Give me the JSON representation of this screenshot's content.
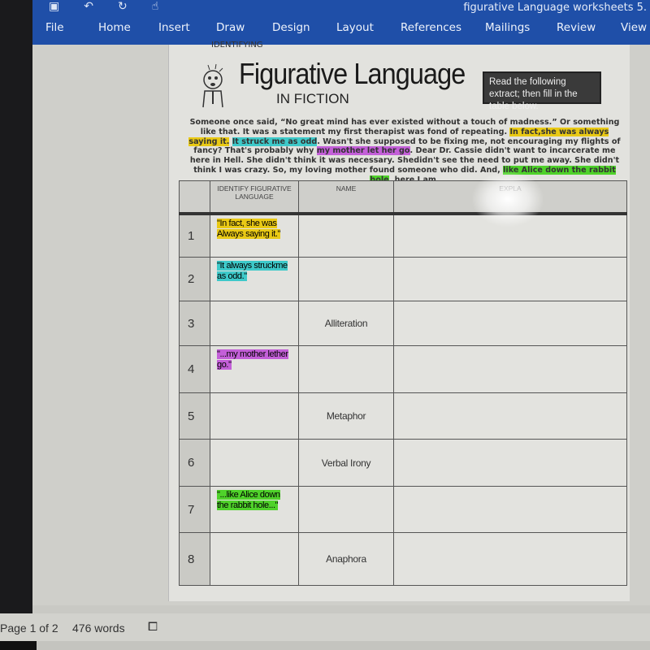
{
  "window": {
    "doc_title": "figurative Language worksheets 5."
  },
  "ribbon": {
    "tabs": [
      "File",
      "Home",
      "Insert",
      "Draw",
      "Design",
      "Layout",
      "References",
      "Mailings",
      "Review",
      "View"
    ]
  },
  "document": {
    "kicker": "IDENTIFYING",
    "title": "Figurative Language",
    "subtitle": "IN FICTION",
    "instructions": "Read the following extract; then fill in the table below.",
    "paragraph": [
      {
        "text": "Someone once said, “No great mind has ever existed without a touch of madness.” Or something like that. It was a statement my first therapist was fond of repeating. ",
        "hl": ""
      },
      {
        "text": "In fact,she was always saying it.",
        "hl": "#e9c915"
      },
      {
        "text": " ",
        "hl": ""
      },
      {
        "text": "It struck me as odd",
        "hl": "#3ec9c9"
      },
      {
        "text": ". Wasn't she supposed to be fixing me, not encouraging my flights of fancy? That's probably why ",
        "hl": ""
      },
      {
        "text": "my mother let her go",
        "hl": "#c35fd8"
      },
      {
        "text": ". Dear Dr. Cassie didn't want to incarcerate me here in Hell. She didn't think it was necessary. Shedidn't see the need to put me away. She didn't think I was crazy. So, my loving mother found someone who did. And, ",
        "hl": ""
      },
      {
        "text": "like Alice down the rabbit hole",
        "hl": "#4fd22a"
      },
      {
        "text": ", here I am.",
        "hl": ""
      }
    ],
    "table": {
      "headers": [
        "",
        "IDENTIFY FIGURATIVE LANGUAGE",
        "NAME",
        "EXPLA"
      ],
      "rows": [
        {
          "num": "1",
          "identify": "\"In fact, she was Always saying it.\"",
          "hl": "#e9c915",
          "name": ""
        },
        {
          "num": "2",
          "identify": "\"It always struckme as odd.\"",
          "hl": "#3ec9c9",
          "name": ""
        },
        {
          "num": "3",
          "identify": "",
          "hl": "",
          "name": "Alliteration"
        },
        {
          "num": "4",
          "identify": "\"...my mother lether go.\"",
          "hl": "#c35fd8",
          "name": ""
        },
        {
          "num": "5",
          "identify": "",
          "hl": "",
          "name": "Metaphor"
        },
        {
          "num": "6",
          "identify": "",
          "hl": "",
          "name": "Verbal Irony"
        },
        {
          "num": "7",
          "identify": "\"...like Alice down the rabbit hole...\"",
          "hl": "#4fd22a",
          "name": ""
        },
        {
          "num": "8",
          "identify": "",
          "hl": "",
          "name": "Anaphora"
        }
      ]
    }
  },
  "status": {
    "page": "Page 1 of 2",
    "words": "476 words"
  }
}
